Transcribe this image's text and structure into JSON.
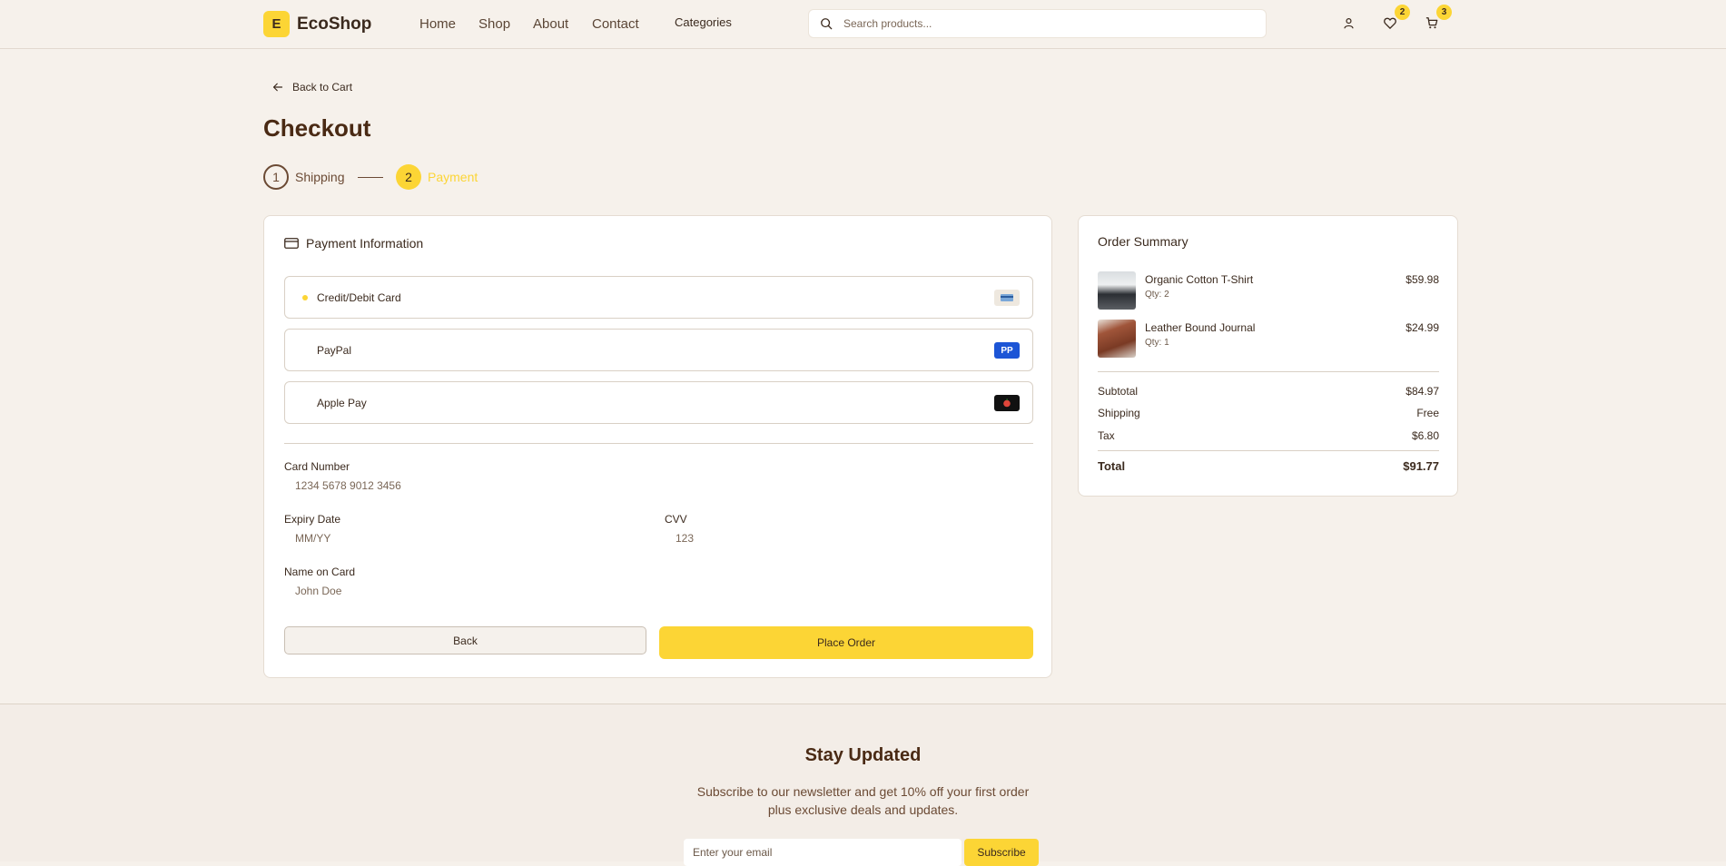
{
  "header": {
    "logo_letter": "E",
    "brand": "EcoShop",
    "nav": {
      "home": "Home",
      "shop": "Shop",
      "about": "About",
      "contact": "Contact",
      "categories": "Categories"
    },
    "search_placeholder": "Search products...",
    "wishlist_count": "2",
    "cart_count": "3"
  },
  "checkout": {
    "back_link": "Back to Cart",
    "title": "Checkout",
    "steps": [
      {
        "number": "1",
        "label": "Shipping",
        "state": "complete"
      },
      {
        "number": "2",
        "label": "Payment",
        "state": "active"
      }
    ],
    "payment": {
      "heading": "Payment Information",
      "selected_method": "Credit/Debit Card",
      "methods": [
        {
          "label": "Credit/Debit Card",
          "icon": "credit-card-icon"
        },
        {
          "label": "PayPal",
          "icon": "paypal-icon",
          "icon_text": "PP"
        },
        {
          "label": "Apple Pay",
          "icon": "apple-pay-icon"
        }
      ],
      "card_number_label": "Card Number",
      "card_number_placeholder": "1234 5678 9012 3456",
      "expiry_label": "Expiry Date",
      "expiry_placeholder": "MM/YY",
      "cvv_label": "CVV",
      "cvv_placeholder": "123",
      "name_label": "Name on Card",
      "name_placeholder": "John Doe",
      "back_button": "Back",
      "place_order_button": "Place Order"
    }
  },
  "summary": {
    "title": "Order Summary",
    "items": [
      {
        "name": "Organic Cotton T-Shirt",
        "qty": "Qty: 2",
        "price": "$59.98"
      },
      {
        "name": "Leather Bound Journal",
        "qty": "Qty: 1",
        "price": "$24.99"
      }
    ],
    "subtotal_label": "Subtotal",
    "subtotal": "$84.97",
    "shipping_label": "Shipping",
    "shipping": "Free",
    "tax_label": "Tax",
    "tax": "$6.80",
    "total_label": "Total",
    "total": "$91.77"
  },
  "newsletter": {
    "title": "Stay Updated",
    "line1": "Subscribe to our newsletter and get 10% off your first order",
    "line2": "plus exclusive deals and updates.",
    "email_placeholder": "Enter your email",
    "button": "Subscribe"
  },
  "colors": {
    "accent": "#fcd535",
    "brand_brown": "#4a2a14",
    "background": "#f6f1eb"
  }
}
